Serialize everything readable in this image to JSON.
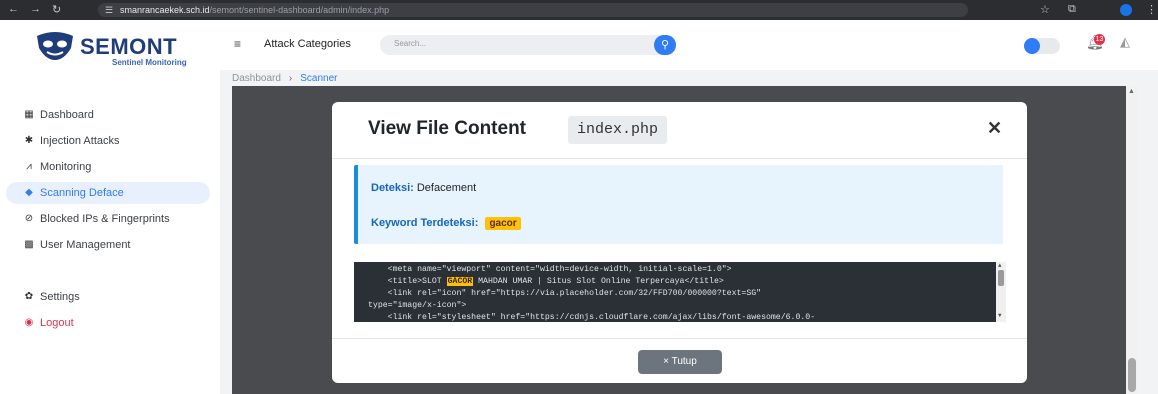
{
  "browser": {
    "url_host": "smanrancaekek.sch.id",
    "url_path": "/semont/sentinel-dashboard/admin/index.php"
  },
  "brand": {
    "name": "SEMONT",
    "tagline": "Sentinel Monitoring"
  },
  "sidebar": {
    "items": [
      {
        "label": "Dashboard",
        "icon": "grid-icon"
      },
      {
        "label": "Injection Attacks",
        "icon": "bug-icon"
      },
      {
        "label": "Monitoring",
        "icon": "chart-icon"
      },
      {
        "label": "Scanning Deface",
        "icon": "scan-icon",
        "active": true
      },
      {
        "label": "Blocked IPs & Fingerprints",
        "icon": "ban-icon"
      },
      {
        "label": "User Management",
        "icon": "users-icon"
      },
      {
        "label": "Settings",
        "icon": "gear-icon"
      },
      {
        "label": "Logout",
        "icon": "logout-icon"
      }
    ]
  },
  "header": {
    "menu_label": "Attack Categories",
    "search_placeholder": "Search...",
    "notification_count": "13"
  },
  "breadcrumb": {
    "root": "Dashboard",
    "current": "Scanner"
  },
  "modal": {
    "title": "View File Content",
    "filename": "index.php",
    "detection_label": "Deteksi:",
    "detection_value": "Defacement",
    "keyword_label": "Keyword Terdeteksi:",
    "keyword_value": "gacor",
    "code": {
      "l1": "    <meta name=\"viewport\" content=\"width=device-width, initial-scale=1.0\">",
      "l2_pre": "    <title>SLOT ",
      "l2_hl": "GACOR",
      "l2_post": " MAHDAN UMAR | Situs Slot Online Terpercaya</title>",
      "l3": "    <link rel=\"icon\" href=\"https://via.placeholder.com/32/FFD700/000000?text=SG\"",
      "l4": "type=\"image/x-icon\">",
      "l5": "    <link rel=\"stylesheet\" href=\"https://cdnjs.cloudflare.com/ajax/libs/font-awesome/6.0.0-"
    },
    "close_button": "× Tutup"
  },
  "colors": {
    "accent": "#2f7cf6",
    "keyword_highlight": "#ffc107",
    "logout": "#e0324b"
  }
}
